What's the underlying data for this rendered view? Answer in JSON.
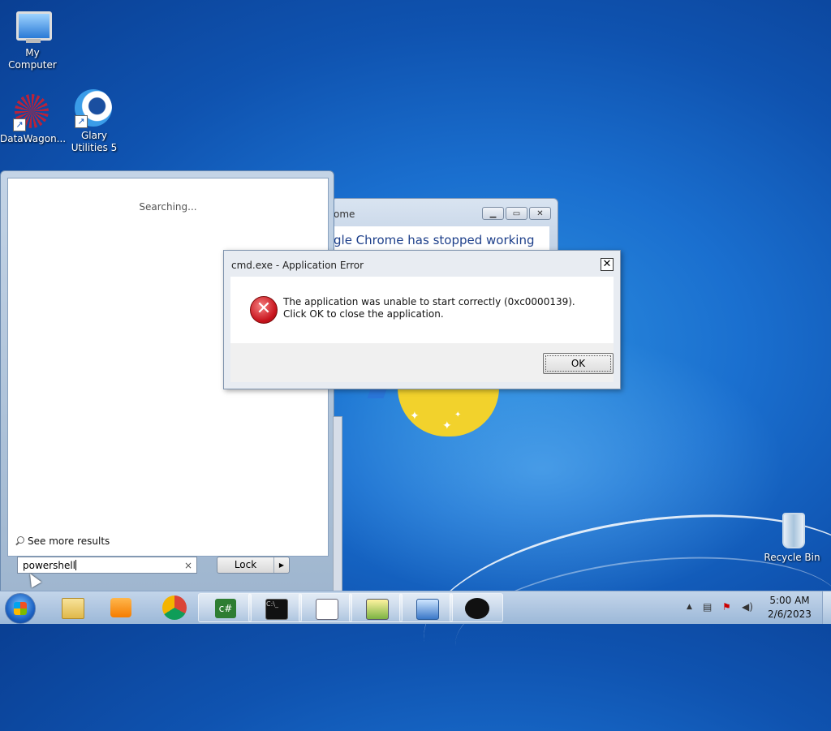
{
  "desktop": {
    "icons": [
      {
        "label": "My Computer"
      },
      {
        "label": "DataWagon..."
      },
      {
        "label": "Glary Utilities 5"
      },
      {
        "label": "Recycle Bin"
      }
    ]
  },
  "start_menu": {
    "status": "Searching...",
    "see_more": "See more results",
    "search_value": "powershell",
    "clear_glyph": "×",
    "power_button": "Lock",
    "power_arrow": "▶"
  },
  "chrome_window": {
    "title": "ome",
    "message": "gle Chrome has stopped working"
  },
  "error_dialog": {
    "title": "cmd.exe - Application Error",
    "message": "The application was unable to start correctly (0xc0000139). Click OK to close the application.",
    "ok_label": "OK",
    "close_glyph": "✕",
    "icon": "error-x-icon"
  },
  "taskbar": {
    "items": [
      {
        "name": "file-explorer-icon"
      },
      {
        "name": "media-player-icon"
      },
      {
        "name": "chrome-icon"
      },
      {
        "name": "csharp-icon"
      },
      {
        "name": "cmd-icon"
      },
      {
        "name": "document-app-icon"
      },
      {
        "name": "checklist-app-icon"
      },
      {
        "name": "remote-desktop-icon"
      },
      {
        "name": "penguin-app-icon"
      }
    ],
    "tray_up": "▲",
    "time": "5:00 AM",
    "date": "2/6/2023"
  },
  "colors": {
    "desktop_blue": "#1a6fcf",
    "error_red": "#c8141d",
    "chrome_text": "#1d3f8a"
  }
}
